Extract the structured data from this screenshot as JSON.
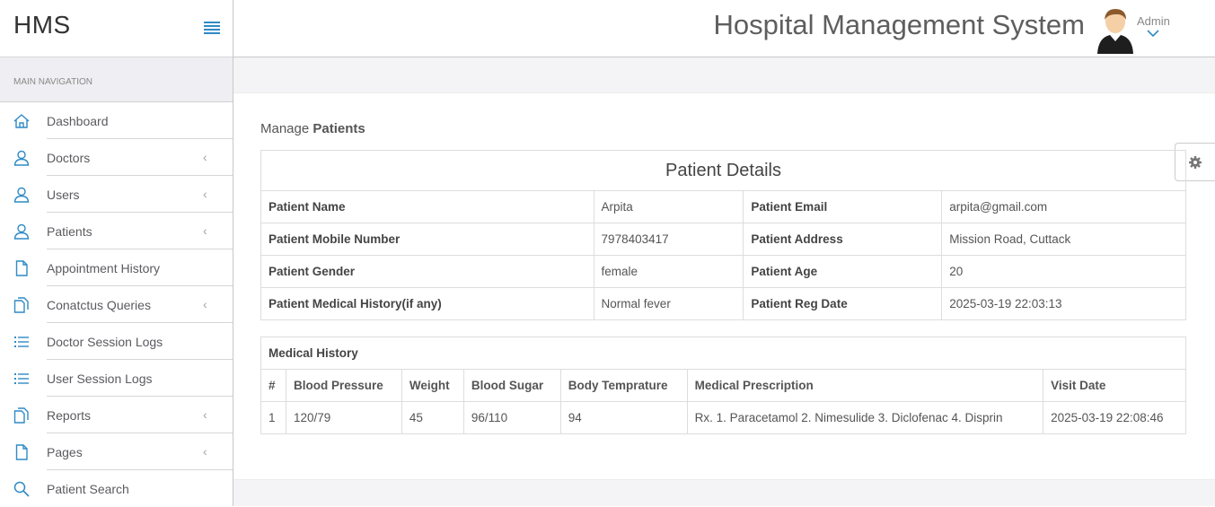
{
  "brand": "HMS",
  "sidebar": {
    "heading": "MAIN NAVIGATION",
    "items": [
      {
        "label": "Dashboard",
        "icon": "home-icon",
        "chevron": false
      },
      {
        "label": "Doctors",
        "icon": "user-icon",
        "chevron": true
      },
      {
        "label": "Users",
        "icon": "user-icon",
        "chevron": true
      },
      {
        "label": "Patients",
        "icon": "user-icon",
        "chevron": true
      },
      {
        "label": "Appointment History",
        "icon": "file-icon",
        "chevron": false
      },
      {
        "label": "Conatctus Queries",
        "icon": "files-icon",
        "chevron": true
      },
      {
        "label": "Doctor Session Logs",
        "icon": "list-icon",
        "chevron": false
      },
      {
        "label": "User Session Logs",
        "icon": "list-icon",
        "chevron": false
      },
      {
        "label": "Reports",
        "icon": "files-icon",
        "chevron": true
      },
      {
        "label": "Pages",
        "icon": "file-icon",
        "chevron": true
      },
      {
        "label": "Patient Search",
        "icon": "search-icon",
        "chevron": false
      }
    ]
  },
  "topbar": {
    "title": "Hospital Management System",
    "user": "Admin"
  },
  "page": {
    "title_light": "Manage ",
    "title_bold": "Patients"
  },
  "details": {
    "caption": "Patient Details",
    "rows": [
      [
        "Patient Name",
        "Arpita",
        "Patient Email",
        "arpita@gmail.com"
      ],
      [
        "Patient Mobile Number",
        "7978403417",
        "Patient Address",
        "Mission Road, Cuttack"
      ],
      [
        "Patient Gender",
        "female",
        "Patient Age",
        "20"
      ],
      [
        "Patient Medical History(if any)",
        "Normal fever",
        "Patient Reg Date",
        "2025-03-19 22:03:13"
      ]
    ]
  },
  "history": {
    "caption": "Medical History",
    "headers": [
      "#",
      "Blood Pressure",
      "Weight",
      "Blood Sugar",
      "Body Temprature",
      "Medical Prescription",
      "Visit Date"
    ],
    "rows": [
      [
        "1",
        "120/79",
        "45",
        "96/110",
        "94",
        "Rx. 1. Paracetamol 2. Nimesulide 3. Diclofenac 4. Disprin",
        "2025-03-19 22:08:46"
      ]
    ]
  },
  "colors": {
    "accent": "#2f8ac6"
  }
}
